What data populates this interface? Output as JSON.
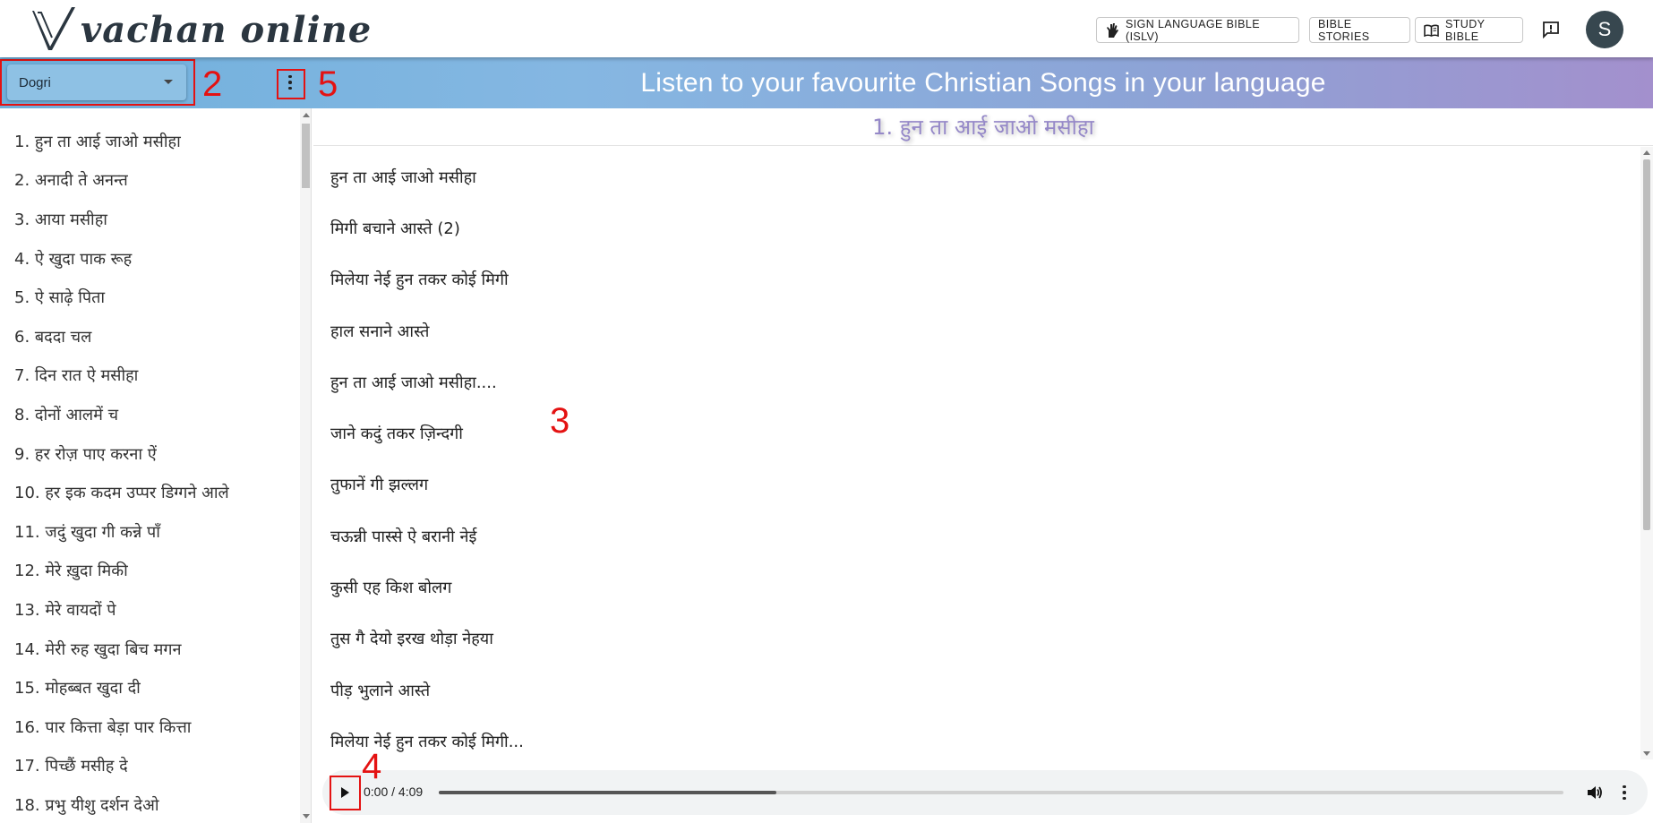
{
  "app": {
    "logo_text": "vachan online"
  },
  "header": {
    "buttons": {
      "sign_language": "SIGN LANGUAGE BIBLE (ISLV)",
      "stories": "BIBLE STORIES",
      "study": "STUDY BIBLE"
    },
    "avatar_initial": "S",
    "icons": [
      "sign-language-icon",
      "book-open-icon",
      "feedback-icon"
    ]
  },
  "topbar": {
    "language": "Dogri",
    "heading": "Listen to your favourite Christian Songs in your language"
  },
  "annotations": {
    "label_language": "2",
    "label_lyrics": "3",
    "label_play": "4",
    "label_menu": "5"
  },
  "sidebar": {
    "songs": [
      "1. हुन ता आई जाओ मसीहा",
      "2. अनादी ते अनन्त",
      "3. आया मसीहा",
      "4. ऐ खुदा पाक रूह",
      "5. ऐ साढ़े पिता",
      "6. बददा चल",
      "7. दिन रात ऐ मसीहा",
      "8. दोनों आलमें च",
      "9. हर रोज़ पाए करना ऐं",
      "10. हर इक कदम उप्पर डिग्गने आले",
      "11. जदुं खुदा गी कन्ने पाँ",
      "12. मेरे ख़ुदा मिकी",
      "13. मेरे वायदों पे",
      "14. मेरी रुह खुदा बिच मगन",
      "15. मोहब्बत खुदा दी",
      "16. पार कित्ता बेड़ा पार कित्ता",
      "17. पिच्छैं मसीह दे",
      "18. प्रभु यीशु दर्शन देओ"
    ]
  },
  "main": {
    "song_title": "1. हुन ता आई जाओ मसीहा",
    "lyrics": [
      "हुन ता आई जाओ मसीहा",
      "मिगी बचाने आस्ते (2)",
      "मिलेया नेई हुन तकर कोई मिगी",
      "हाल सनाने आस्ते",
      "हुन ता आई जाओ मसीहा....",
      "जाने कदुं तकर ज़िन्दगी",
      "तुफानें गी झल्लग",
      "चऊन्नी पास्से ऐ बरानी नेई",
      "कुसी एह किश बोलग",
      "तुस गै देयो इरख थोड़ा नेहया",
      "पीड़ भुलाने आस्ते",
      "मिलेया नेई हुन तकर कोई मिगी..."
    ]
  },
  "player": {
    "time": "0:00 / 4:09",
    "progress": 0.3
  }
}
